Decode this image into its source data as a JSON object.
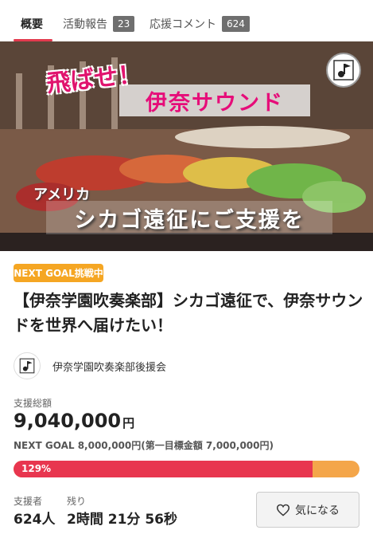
{
  "tabs": [
    {
      "label": "概要",
      "count": null
    },
    {
      "label": "活動報告",
      "count": "23"
    },
    {
      "label": "応援コメント",
      "count": "624"
    }
  ],
  "hero": {
    "line1": "飛ばせ！",
    "line2": "伊奈サウンド",
    "line3": "アメリカ",
    "line4": "シカゴ遠征にご支援を"
  },
  "badge": "NEXT GOAL挑戦中",
  "title": "【伊奈学園吹奏楽部】シカゴ遠征で、伊奈サウンドを世界へ届けたい！",
  "organizer": "伊奈学園吹奏楽部後援会",
  "total": {
    "label": "支援総額",
    "amount": "9,040,000",
    "unit": "円"
  },
  "goal_text": "NEXT GOAL 8,000,000円(第一目標金額 7,000,000円)",
  "progress": {
    "label": "129%",
    "fraction": 1.0
  },
  "supporters": {
    "label": "支援者",
    "value": "624人"
  },
  "remaining": {
    "label": "残り",
    "value": "2時間 21分 56秒"
  },
  "favorite_label": "気になる",
  "colors": {
    "accent": "#e8364f",
    "progress_bg": "#f4a64a",
    "badge": "#f5a623"
  }
}
